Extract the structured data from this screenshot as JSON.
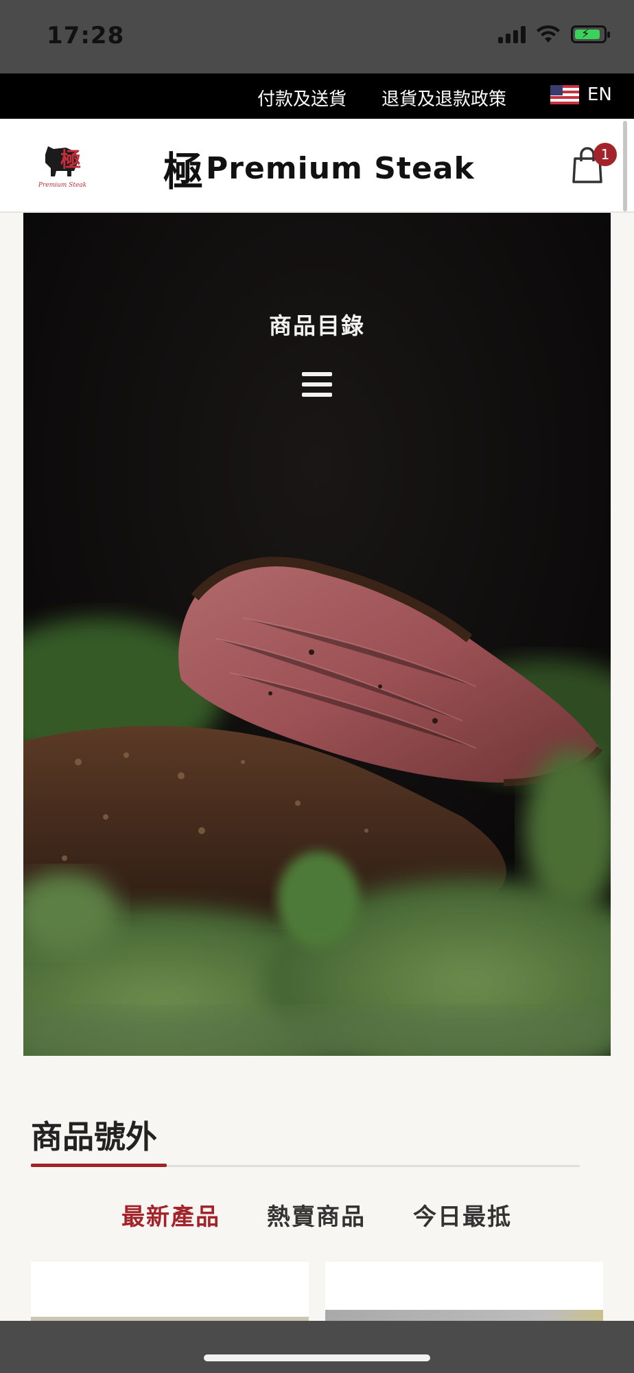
{
  "status_bar": {
    "time": "17:28"
  },
  "top_strip": {
    "payment_link": "付款及送貨",
    "returns_link": "退貨及退款政策",
    "language": "EN",
    "flag_icon": "us-flag-icon"
  },
  "header": {
    "logo_caption": "Premium Steak",
    "logo_kanji": "極",
    "brand_kanji": "極",
    "brand_text": "Premium Steak",
    "cart_icon": "shopping-bag-icon",
    "cart_count": "1"
  },
  "hero": {
    "title": "商品目錄",
    "menu_icon": "hamburger-menu-icon"
  },
  "section": {
    "title": "商品號外",
    "tabs": [
      {
        "label": "最新產品",
        "active": true
      },
      {
        "label": "熱賣商品",
        "active": false
      },
      {
        "label": "今日最抵",
        "active": false
      }
    ]
  },
  "colors": {
    "accent": "#a3232b",
    "topbar": "#000000",
    "statusbar": "#4b4b4b"
  }
}
